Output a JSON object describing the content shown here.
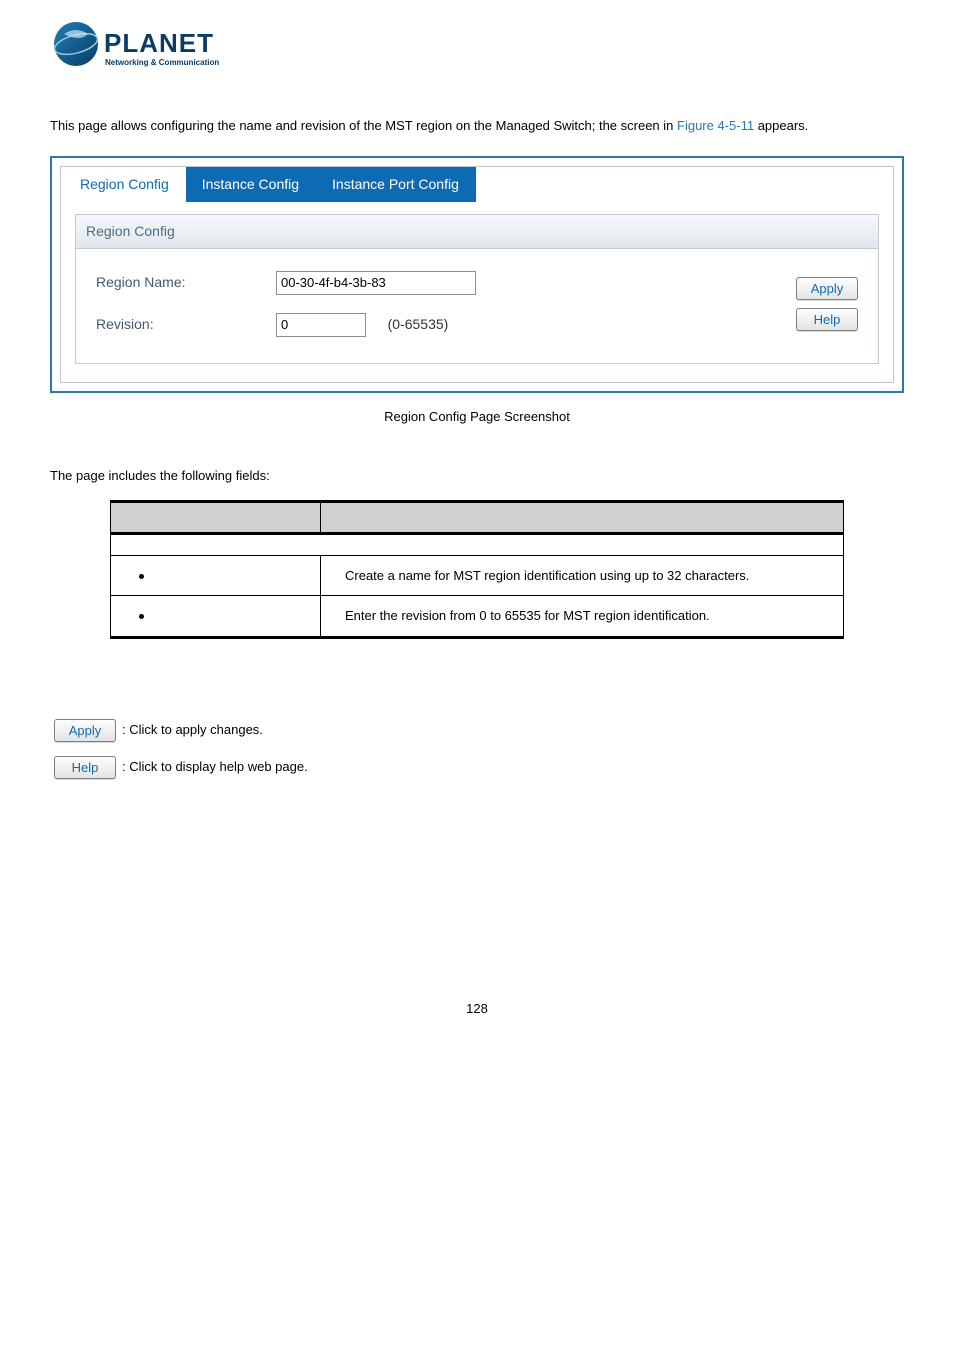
{
  "logo": {
    "brand": "PLANET",
    "tagline": "Networking & Communication"
  },
  "intro": {
    "text_prefix": "This page allows configuring the name and revision of the MST region on the Managed Switch; the screen in ",
    "fig_ref": "Figure 4-5-11",
    "text_suffix": " appears."
  },
  "screenshot": {
    "tabs": [
      {
        "label": "Region Config",
        "active": false
      },
      {
        "label": "Instance Config",
        "active": true
      },
      {
        "label": "Instance Port Config",
        "active": true
      }
    ],
    "section_title": "Region Config",
    "fields": {
      "region_name_label": "Region Name:",
      "region_name_value": "00-30-4f-b4-3b-83",
      "revision_label": "Revision:",
      "revision_value": "0",
      "revision_range": "(0-65535)"
    },
    "buttons": {
      "apply": "Apply",
      "help": "Help"
    }
  },
  "caption": "Region Config Page Screenshot",
  "fields_intro": "The page includes the following fields:",
  "table": {
    "rows": [
      {
        "desc": "Create a name for MST region identification using up to 32 characters."
      },
      {
        "desc": "Enter the revision from 0 to 65535 for MST region identification."
      }
    ]
  },
  "button_explain": {
    "apply": {
      "btn": "Apply",
      "text": ": Click to apply changes."
    },
    "help": {
      "btn": "Help",
      "text": ": Click to display help web page."
    }
  },
  "page_number": "128"
}
